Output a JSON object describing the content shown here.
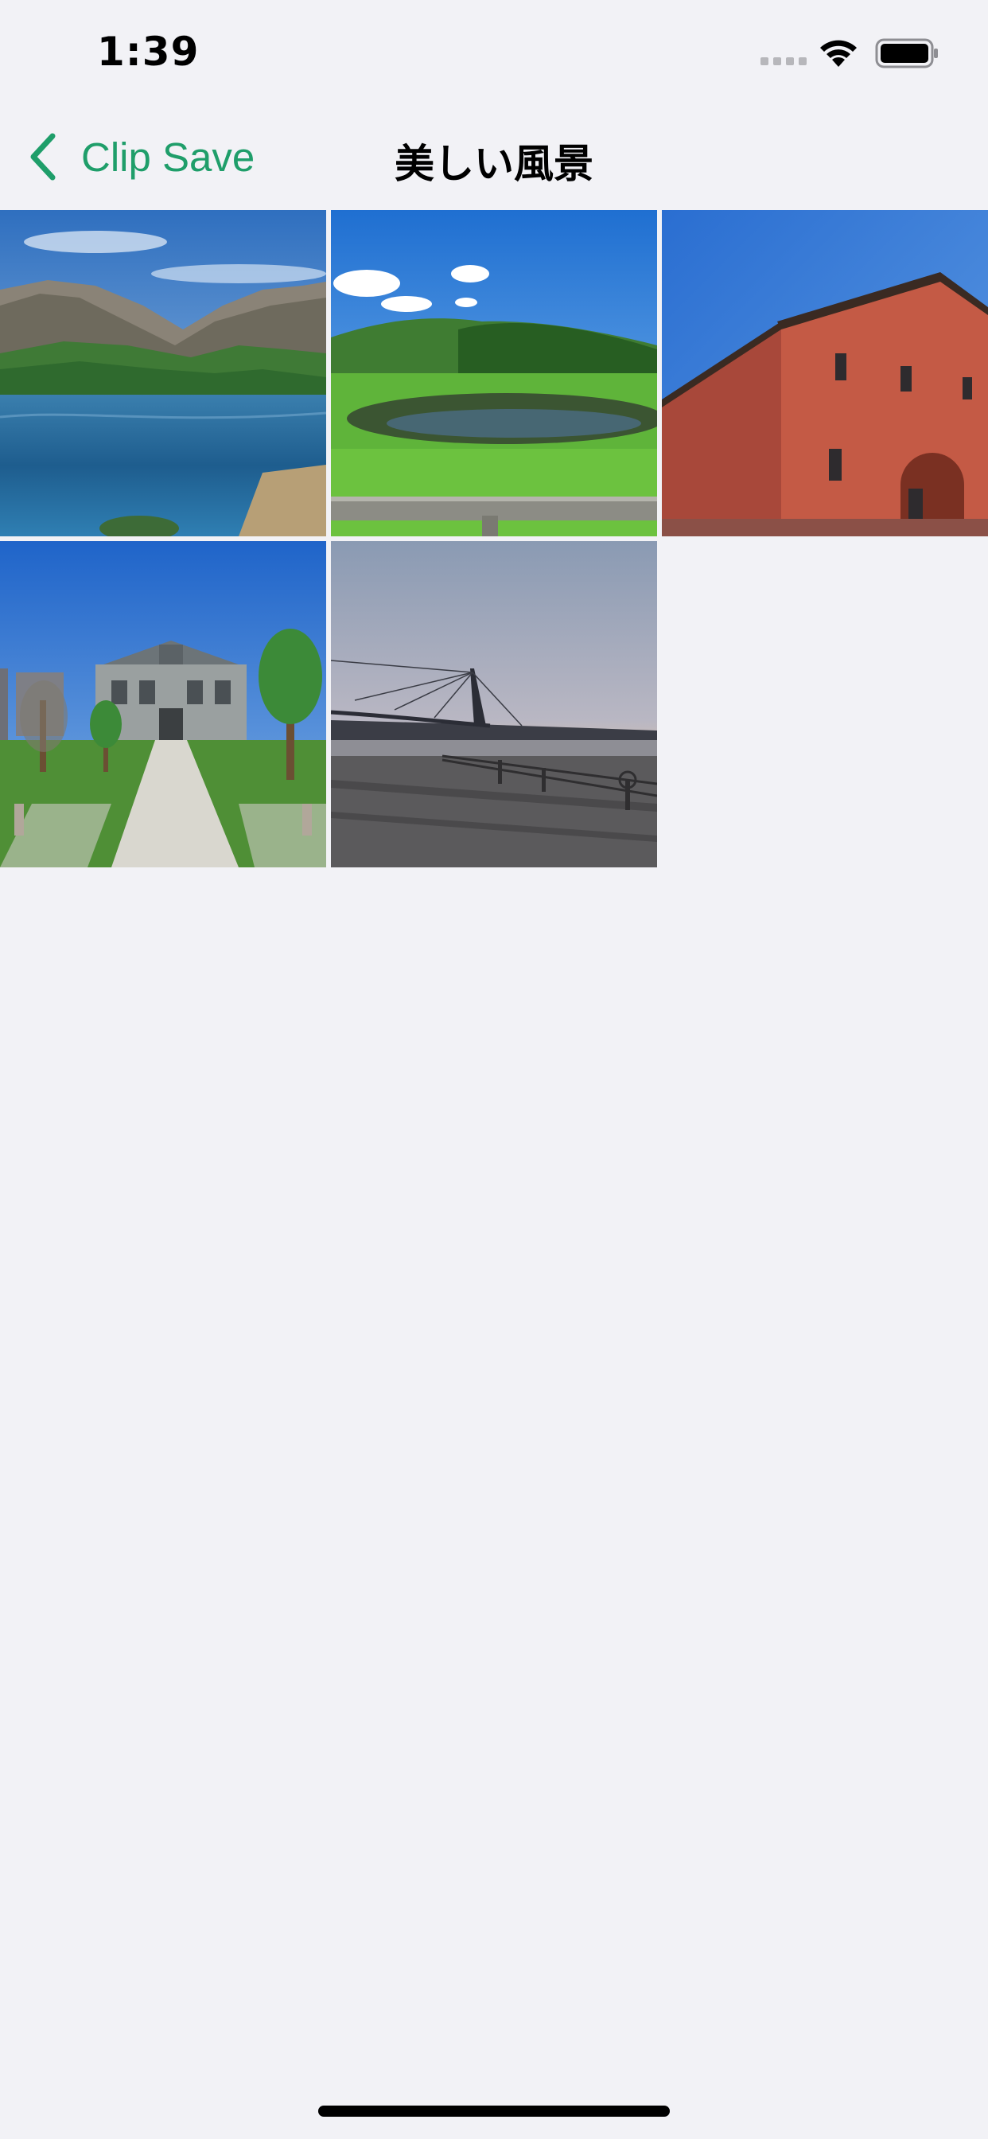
{
  "status_bar": {
    "time": "1:39",
    "icons": [
      "signal-dots-icon",
      "wifi-icon",
      "battery-icon"
    ]
  },
  "nav": {
    "back_label": "Clip Save",
    "back_icon": "chevron-left-icon",
    "title": "美しい風景",
    "accent_color": "#1f9e6a"
  },
  "photos": [
    {
      "subject": "mountain-lake-photo"
    },
    {
      "subject": "green-meadow-pond-photo"
    },
    {
      "subject": "red-brick-warehouse-photo"
    },
    {
      "subject": "historic-building-plaza-photo"
    },
    {
      "subject": "harbor-bridge-sunset-photo"
    }
  ]
}
